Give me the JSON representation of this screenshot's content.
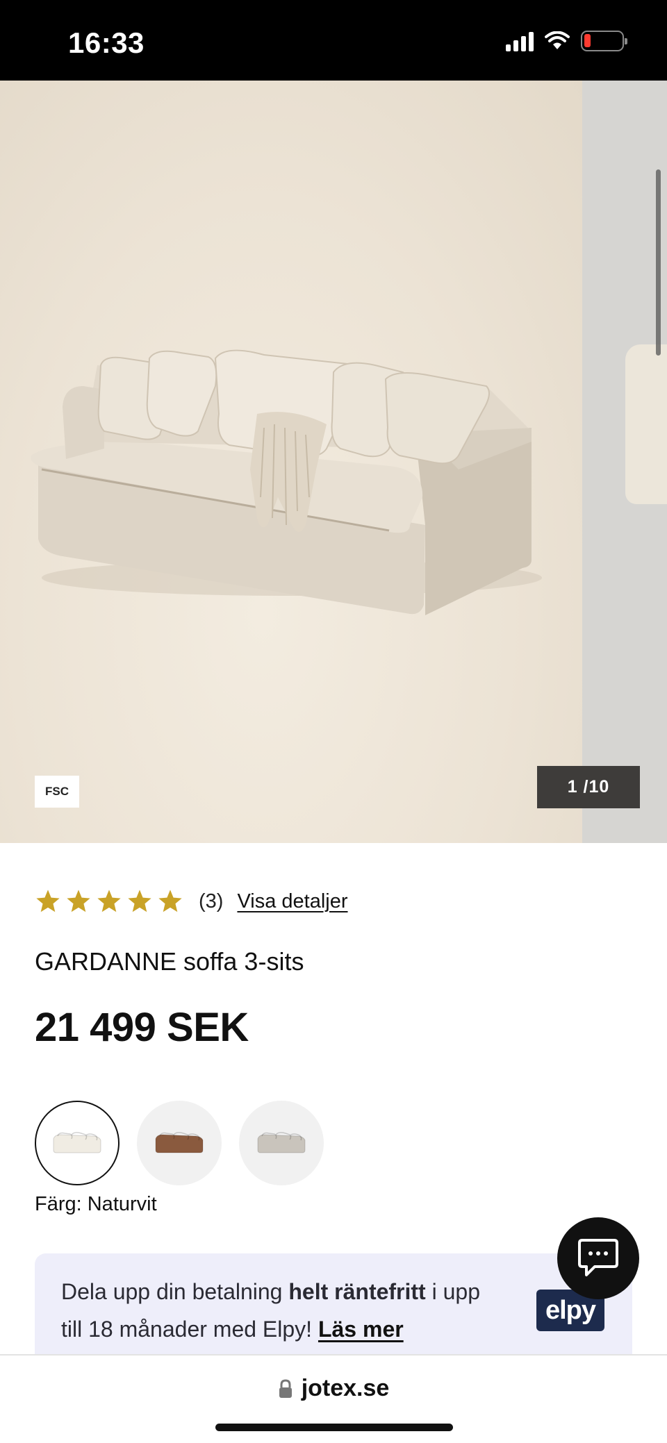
{
  "status_bar": {
    "time": "16:33",
    "icons": [
      "signal-icon",
      "wifi-icon",
      "battery-icon"
    ],
    "battery_color": "#ff3b30"
  },
  "gallery": {
    "badge": "FSC",
    "counter": "1 /10",
    "image": "sofa-image"
  },
  "product": {
    "rating": 5,
    "rating_max": 5,
    "review_count": "(3)",
    "details_link": "Visa detaljer",
    "title": "GARDANNE soffa 3-sits",
    "price": "21 499 SEK",
    "star_color": "#c9a227"
  },
  "swatches": [
    {
      "name": "Naturvit",
      "color": "#f0ece3",
      "selected": true
    },
    {
      "name": "brown",
      "color": "#8a5a3e",
      "selected": false
    },
    {
      "name": "grey",
      "color": "#c9c4bc",
      "selected": false
    }
  ],
  "color_label": "Färg: Naturvit",
  "elpy": {
    "text_before": "Dela upp din betalning ",
    "text_bold": "helt räntefritt",
    "text_after": " i upp till 18 månader med Elpy! ",
    "link": "Läs mer",
    "logo": "elpy",
    "logo_color": "#1d2b4d"
  },
  "browser": {
    "url": "jotex.se"
  }
}
